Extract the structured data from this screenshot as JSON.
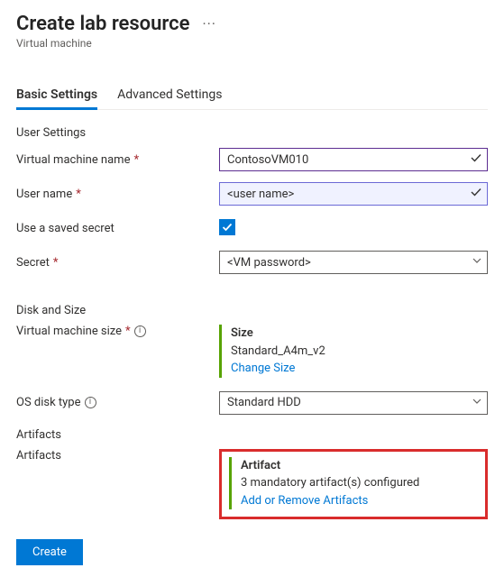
{
  "header": {
    "title": "Create lab resource",
    "subtitle": "Virtual machine",
    "more_label": "···"
  },
  "tabs": {
    "basic": "Basic Settings",
    "advanced": "Advanced Settings"
  },
  "sections": {
    "user_settings": "User Settings",
    "disk_and_size": "Disk and Size",
    "artifacts": "Artifacts"
  },
  "fields": {
    "vm_name": {
      "label": "Virtual machine name",
      "value": "ContosoVM010"
    },
    "user_name": {
      "label": "User name",
      "value": "<user name>"
    },
    "saved_secret": {
      "label": "Use a saved secret",
      "checked": true
    },
    "secret": {
      "label": "Secret",
      "value": "<VM password>"
    },
    "vm_size": {
      "label": "Virtual machine size",
      "heading": "Size",
      "value": "Standard_A4m_v2",
      "action": "Change Size"
    },
    "os_disk": {
      "label": "OS disk type",
      "value": "Standard HDD"
    },
    "artifacts": {
      "label": "Artifacts",
      "heading": "Artifact",
      "summary": "3 mandatory artifact(s) configured",
      "action": "Add or Remove Artifacts"
    }
  },
  "footer": {
    "create": "Create"
  }
}
